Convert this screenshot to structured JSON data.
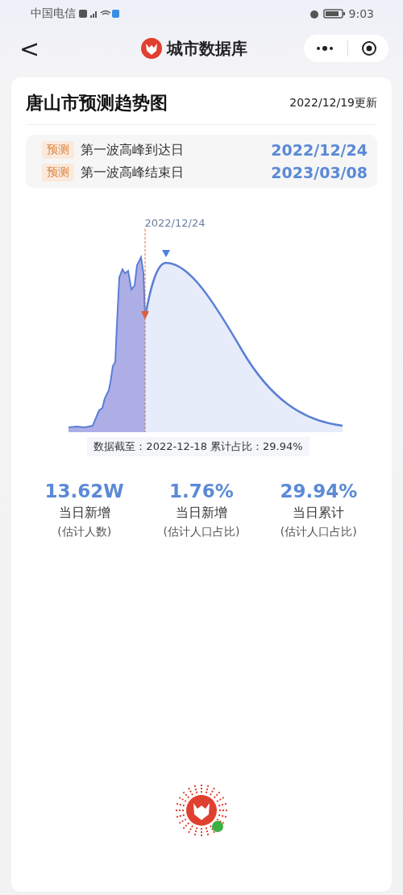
{
  "status_bar": {
    "carrier": "中国电信",
    "time": "9:03"
  },
  "nav": {
    "back": "<",
    "title": "城市数据库"
  },
  "card": {
    "title": "唐山市预测趋势图",
    "updated": "2022/12/19更新",
    "predictions": [
      {
        "tag": "预测",
        "label": "第一波高峰到达日",
        "date": "2022/12/24"
      },
      {
        "tag": "预测",
        "label": "第一波高峰结束日",
        "date": "2023/03/08"
      }
    ],
    "trend": {
      "marker_label": "2022/12/24",
      "caption": "数据截至：2022-12-18  累计占比：29.94%"
    },
    "stats": [
      {
        "value": "13.62W",
        "label": "当日新增",
        "note": "(估计人数)"
      },
      {
        "value": "1.76%",
        "label": "当日新增",
        "note": "(估计人口占比)"
      },
      {
        "value": "29.94%",
        "label": "当日累计",
        "note": "(估计人口占比)"
      }
    ]
  }
}
